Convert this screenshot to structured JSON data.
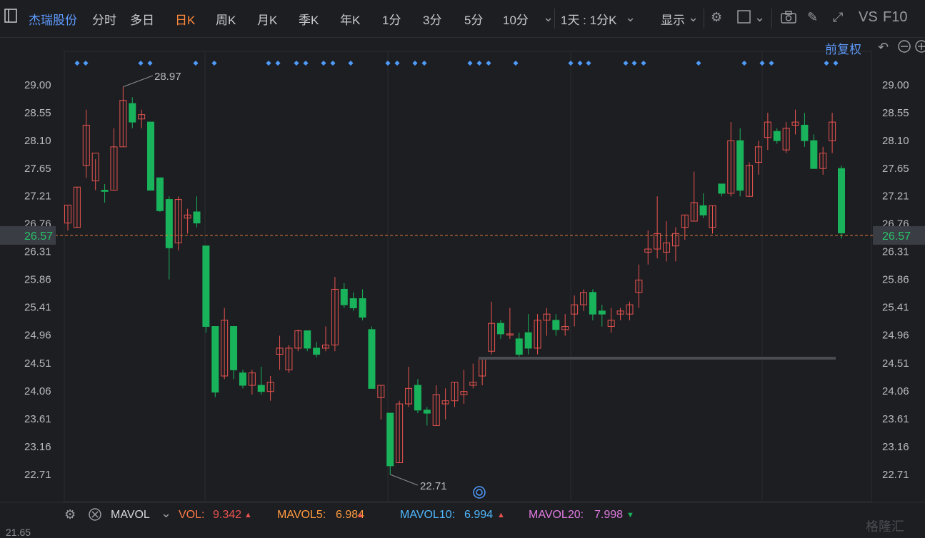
{
  "toolbar": {
    "stock_name": "杰瑞股份",
    "tabs": [
      "分时",
      "多日",
      "日K",
      "周K",
      "月K",
      "季K",
      "年K",
      "1分",
      "3分",
      "5分",
      "10分"
    ],
    "active_tab": "日K",
    "period_select": "1天 : 1分K",
    "display_label": "显示",
    "vs_label": "VS",
    "f10_label": "F10"
  },
  "adjust_label": "前复权",
  "colors": {
    "up": "#e8534f",
    "down": "#19b35b",
    "grid": "#2b2c30",
    "axis_text": "#b9babe",
    "price_line": "#e07a3b",
    "accent": "#ff8a3d",
    "marker": "#4f9cff"
  },
  "chart_data": {
    "type": "candlestick",
    "y_ticks": [
      "29.00",
      "28.55",
      "28.10",
      "27.65",
      "27.21",
      "26.76",
      "26.31",
      "25.86",
      "25.41",
      "24.96",
      "24.51",
      "24.06",
      "23.61",
      "23.16",
      "22.71"
    ],
    "ylim": [
      22.71,
      29.0
    ],
    "current_price": "26.57",
    "high_label": "28.97",
    "low_label": "22.71",
    "candles": [
      {
        "o": 26.77,
        "h": 27.05,
        "l": 26.65,
        "c": 27.06
      },
      {
        "o": 26.7,
        "h": 27.35,
        "l": 26.7,
        "c": 27.35
      },
      {
        "o": 27.7,
        "h": 28.6,
        "l": 27.5,
        "c": 28.35
      },
      {
        "o": 27.45,
        "h": 27.8,
        "l": 27.3,
        "c": 27.9
      },
      {
        "o": 27.3,
        "h": 27.4,
        "l": 27.1,
        "c": 27.28
      },
      {
        "o": 27.3,
        "h": 28.3,
        "l": 27.3,
        "c": 28.0
      },
      {
        "o": 28.0,
        "h": 28.97,
        "l": 28.0,
        "c": 28.75
      },
      {
        "o": 28.7,
        "h": 28.8,
        "l": 28.3,
        "c": 28.4
      },
      {
        "o": 28.45,
        "h": 28.6,
        "l": 28.3,
        "c": 28.52
      },
      {
        "o": 28.4,
        "h": 28.4,
        "l": 27.3,
        "c": 27.3
      },
      {
        "o": 27.5,
        "h": 27.5,
        "l": 26.95,
        "c": 26.97
      },
      {
        "o": 27.15,
        "h": 27.2,
        "l": 25.86,
        "c": 26.37
      },
      {
        "o": 26.45,
        "h": 27.2,
        "l": 26.33,
        "c": 27.15
      },
      {
        "o": 26.85,
        "h": 27.0,
        "l": 26.6,
        "c": 26.9
      },
      {
        "o": 26.95,
        "h": 27.2,
        "l": 26.7,
        "c": 26.77
      },
      {
        "o": 26.4,
        "h": 26.4,
        "l": 25.0,
        "c": 25.1
      },
      {
        "o": 25.1,
        "h": 25.1,
        "l": 23.96,
        "c": 24.04
      },
      {
        "o": 24.3,
        "h": 25.4,
        "l": 24.25,
        "c": 25.2
      },
      {
        "o": 25.1,
        "h": 25.1,
        "l": 24.25,
        "c": 24.4
      },
      {
        "o": 24.35,
        "h": 24.4,
        "l": 24.1,
        "c": 24.15
      },
      {
        "o": 24.15,
        "h": 24.4,
        "l": 24.0,
        "c": 24.35
      },
      {
        "o": 24.15,
        "h": 24.45,
        "l": 24.0,
        "c": 24.05
      },
      {
        "o": 24.05,
        "h": 24.3,
        "l": 23.9,
        "c": 24.2
      },
      {
        "o": 24.65,
        "h": 24.95,
        "l": 24.4,
        "c": 24.75
      },
      {
        "o": 24.4,
        "h": 24.8,
        "l": 24.35,
        "c": 24.75
      },
      {
        "o": 24.75,
        "h": 25.05,
        "l": 24.7,
        "c": 25.03
      },
      {
        "o": 25.03,
        "h": 25.03,
        "l": 24.7,
        "c": 24.75
      },
      {
        "o": 24.75,
        "h": 24.85,
        "l": 24.6,
        "c": 24.65
      },
      {
        "o": 24.75,
        "h": 25.1,
        "l": 24.7,
        "c": 24.8
      },
      {
        "o": 24.8,
        "h": 25.9,
        "l": 24.7,
        "c": 25.7
      },
      {
        "o": 25.7,
        "h": 25.8,
        "l": 25.4,
        "c": 25.45
      },
      {
        "o": 25.55,
        "h": 25.65,
        "l": 25.35,
        "c": 25.4
      },
      {
        "o": 25.55,
        "h": 25.7,
        "l": 25.2,
        "c": 25.25
      },
      {
        "o": 25.05,
        "h": 25.1,
        "l": 24.1,
        "c": 24.1
      },
      {
        "o": 23.95,
        "h": 24.15,
        "l": 23.6,
        "c": 24.15
      },
      {
        "o": 23.7,
        "h": 23.7,
        "l": 22.71,
        "c": 22.85
      },
      {
        "o": 22.9,
        "h": 23.9,
        "l": 22.9,
        "c": 23.85
      },
      {
        "o": 23.85,
        "h": 24.45,
        "l": 23.8,
        "c": 24.1
      },
      {
        "o": 24.15,
        "h": 24.25,
        "l": 23.7,
        "c": 23.75
      },
      {
        "o": 23.75,
        "h": 23.8,
        "l": 23.5,
        "c": 23.7
      },
      {
        "o": 23.5,
        "h": 24.15,
        "l": 23.5,
        "c": 24.0
      },
      {
        "o": 23.85,
        "h": 24.1,
        "l": 23.6,
        "c": 23.9
      },
      {
        "o": 23.9,
        "h": 24.2,
        "l": 23.8,
        "c": 24.2
      },
      {
        "o": 24.0,
        "h": 24.4,
        "l": 23.85,
        "c": 24.05
      },
      {
        "o": 24.15,
        "h": 24.5,
        "l": 24.1,
        "c": 24.2
      },
      {
        "o": 24.3,
        "h": 24.6,
        "l": 24.15,
        "c": 24.58
      },
      {
        "o": 24.7,
        "h": 25.5,
        "l": 24.65,
        "c": 25.15
      },
      {
        "o": 25.15,
        "h": 25.2,
        "l": 24.9,
        "c": 24.98
      },
      {
        "o": 24.96,
        "h": 25.4,
        "l": 24.9,
        "c": 24.98
      },
      {
        "o": 24.9,
        "h": 25.0,
        "l": 24.6,
        "c": 24.65
      },
      {
        "o": 25.0,
        "h": 25.3,
        "l": 24.65,
        "c": 24.75
      },
      {
        "o": 24.75,
        "h": 25.3,
        "l": 24.65,
        "c": 25.2
      },
      {
        "o": 25.2,
        "h": 25.4,
        "l": 24.95,
        "c": 25.3
      },
      {
        "o": 25.2,
        "h": 25.3,
        "l": 24.95,
        "c": 25.05
      },
      {
        "o": 25.05,
        "h": 25.3,
        "l": 24.95,
        "c": 25.1
      },
      {
        "o": 25.3,
        "h": 25.6,
        "l": 25.1,
        "c": 25.45
      },
      {
        "o": 25.45,
        "h": 25.7,
        "l": 25.35,
        "c": 25.65
      },
      {
        "o": 25.65,
        "h": 25.7,
        "l": 25.2,
        "c": 25.3
      },
      {
        "o": 25.35,
        "h": 25.45,
        "l": 25.1,
        "c": 25.3
      },
      {
        "o": 25.1,
        "h": 25.4,
        "l": 25.0,
        "c": 25.2
      },
      {
        "o": 25.3,
        "h": 25.4,
        "l": 25.2,
        "c": 25.35
      },
      {
        "o": 25.3,
        "h": 25.5,
        "l": 25.2,
        "c": 25.45
      },
      {
        "o": 25.65,
        "h": 26.1,
        "l": 25.4,
        "c": 25.85
      },
      {
        "o": 26.3,
        "h": 26.65,
        "l": 26.1,
        "c": 26.35
      },
      {
        "o": 26.35,
        "h": 27.2,
        "l": 26.2,
        "c": 26.6
      },
      {
        "o": 26.3,
        "h": 26.8,
        "l": 26.15,
        "c": 26.45
      },
      {
        "o": 26.4,
        "h": 26.7,
        "l": 26.15,
        "c": 26.6
      },
      {
        "o": 26.7,
        "h": 26.9,
        "l": 26.5,
        "c": 26.9
      },
      {
        "o": 26.8,
        "h": 27.6,
        "l": 26.8,
        "c": 27.1
      },
      {
        "o": 27.05,
        "h": 27.25,
        "l": 26.85,
        "c": 26.9
      },
      {
        "o": 26.7,
        "h": 27.05,
        "l": 26.6,
        "c": 27.05
      },
      {
        "o": 27.4,
        "h": 27.4,
        "l": 27.2,
        "c": 27.25
      },
      {
        "o": 27.25,
        "h": 28.4,
        "l": 27.2,
        "c": 28.1
      },
      {
        "o": 28.1,
        "h": 28.3,
        "l": 27.2,
        "c": 27.3
      },
      {
        "o": 27.2,
        "h": 27.75,
        "l": 27.2,
        "c": 27.7
      },
      {
        "o": 27.75,
        "h": 28.1,
        "l": 27.55,
        "c": 28.0
      },
      {
        "o": 28.15,
        "h": 28.55,
        "l": 27.95,
        "c": 28.4
      },
      {
        "o": 28.25,
        "h": 28.3,
        "l": 28.05,
        "c": 28.1
      },
      {
        "o": 27.95,
        "h": 28.4,
        "l": 27.9,
        "c": 28.3
      },
      {
        "o": 28.35,
        "h": 28.6,
        "l": 28.2,
        "c": 28.4
      },
      {
        "o": 28.35,
        "h": 28.55,
        "l": 28.0,
        "c": 28.1
      },
      {
        "o": 28.1,
        "h": 28.2,
        "l": 27.65,
        "c": 27.65
      },
      {
        "o": 27.65,
        "h": 28.0,
        "l": 27.55,
        "c": 27.9
      },
      {
        "o": 28.1,
        "h": 28.55,
        "l": 27.9,
        "c": 28.4
      },
      {
        "o": 27.65,
        "h": 27.7,
        "l": 26.52,
        "c": 26.61
      }
    ]
  },
  "indicator": {
    "name": "MAVOL",
    "items": [
      {
        "label": "VOL:",
        "value": "9.342",
        "color": "#e8534f",
        "label_color": "#ff7a45",
        "arrow": "up"
      },
      {
        "label": "MAVOL5:",
        "value": "6.984",
        "color": "#ff9a3d",
        "label_color": "#ff9a3d",
        "arrow": "up"
      },
      {
        "label": "MAVOL10:",
        "value": "6.994",
        "color": "#4fb8ff",
        "label_color": "#4fb8ff",
        "arrow": "up"
      },
      {
        "label": "MAVOL20:",
        "value": "7.998",
        "color": "#e07ae0",
        "label_color": "#e07ae0",
        "arrow": "down"
      }
    ],
    "bottom_tick": "21.65"
  },
  "watermark": "格隆汇"
}
